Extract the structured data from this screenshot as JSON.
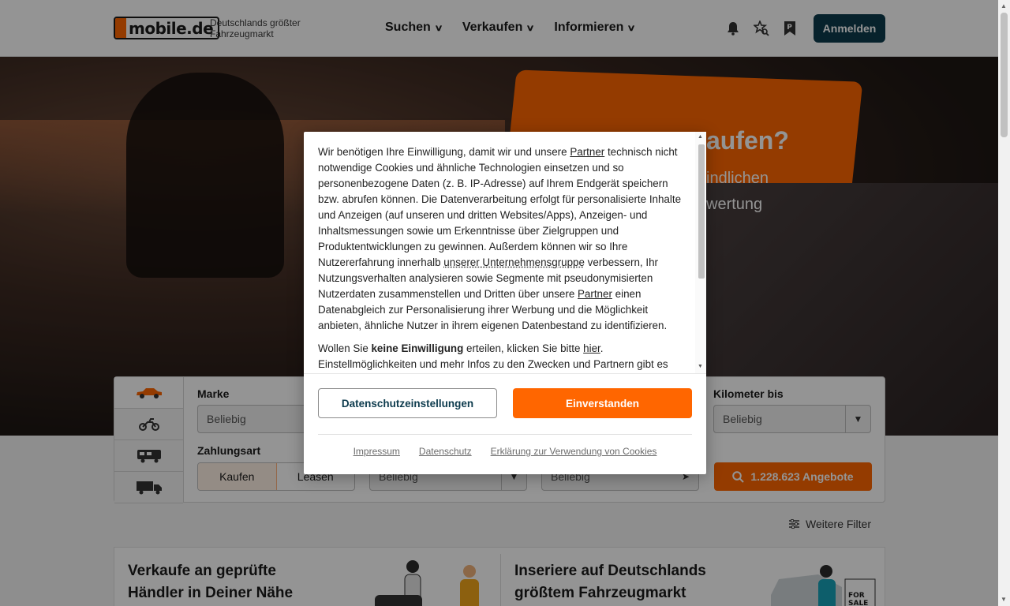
{
  "header": {
    "logo_text": "mobile.de",
    "tagline_line1": "Deutschlands größter",
    "tagline_line2": "Fahrzeugmarkt",
    "nav": [
      {
        "label": "Suchen"
      },
      {
        "label": "Verkaufen"
      },
      {
        "label": "Informieren"
      }
    ],
    "icons": [
      "bell-icon",
      "saved-search-icon",
      "parked-vehicles-icon"
    ],
    "login_label": "Anmelden",
    "colors": {
      "brand": "#ff6600",
      "primary_dark": "#0d3b4d"
    }
  },
  "hero": {
    "title_fragment": "aufen?",
    "sub_line1": "indlichen",
    "sub_line2": "wertung"
  },
  "search": {
    "vehicle_tabs": [
      "car-icon",
      "motorbike-icon",
      "motorhome-icon",
      "truck-icon"
    ],
    "make_label": "Marke",
    "make_value": "Beliebig",
    "km_label": "Kilometer bis",
    "km_value": "Beliebig",
    "payment_label": "Zahlungsart",
    "payment_options": [
      "Kaufen",
      "Leasen"
    ],
    "payment_selected": "Kaufen",
    "price_value": "Beliebig",
    "location_value": "Beliebig",
    "offers_label": "1.228.623 Angebote",
    "more_filters_label": "Weitere Filter"
  },
  "teasers": [
    {
      "line1": "Verkaufe an geprüfte",
      "line2": "Händler in Deiner Nähe"
    },
    {
      "line1": "Inseriere auf Deutschlands",
      "line2": "größtem Fahrzeugmarkt"
    }
  ],
  "consent": {
    "p1_a": "Wir benötigen Ihre Einwilligung, damit wir und unsere ",
    "p1_partner1": "Partner",
    "p1_b": " technisch nicht notwendige Cookies und ähnliche Technologien einsetzen und so personenbezogene Daten (z. B. IP-Adresse) auf Ihrem Endgerät speichern bzw. abrufen können. Die Datenverarbeitung erfolgt für personalisierte Inhalte und Anzeigen (auf unseren und dritten Websites/Apps), Anzeigen- und Inhaltsmessungen sowie um Erkenntnisse über Zielgruppen und Produktentwicklungen zu gewinnen. Außerdem können wir so Ihre Nutzererfahrung innerhalb ",
    "p1_group": "unserer Unternehmensgruppe",
    "p1_c": " verbessern, Ihr Nutzungsverhalten analysieren sowie Segmente mit pseudonymisierten Nutzerdaten zusammenstellen und Dritten über unsere ",
    "p1_partner2": "Partner",
    "p1_d": " einen Datenabgleich zur Personalisierung ihrer Werbung und die Möglichkeit anbieten, ähnliche Nutzer in ihrem eigenen Datenbestand zu identifizieren.",
    "p2_a": "Wollen Sie ",
    "p2_bold": "keine Einwilligung",
    "p2_b": " erteilen, klicken Sie bitte ",
    "p2_link": "hier",
    "p2_c": ". Einstellmöglichkeiten und mehr Infos zu den Zwecken und Partnern gibt es",
    "settings_label": "Datenschutzeinstellungen",
    "accept_label": "Einverstanden",
    "footer_links": [
      "Impressum",
      "Datenschutz",
      "Erklärung zur Verwendung von Cookies"
    ]
  }
}
